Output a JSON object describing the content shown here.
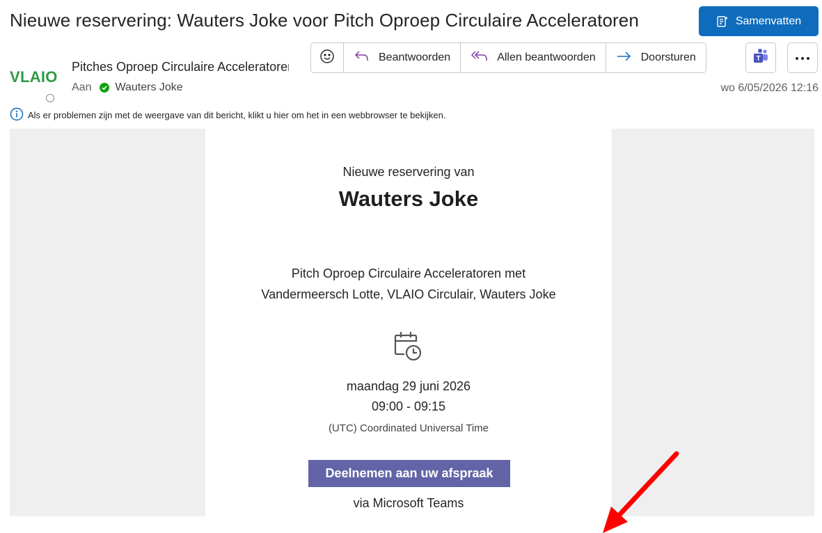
{
  "subject": "Nieuwe reservering: Wauters Joke voor Pitch Oproep Circulaire Acceleratoren",
  "summarize_label": "Samenvatten",
  "sender": {
    "logo_text": "VLAIO",
    "name": "Pitches Oproep Circulaire Acceleratoren",
    "to_label": "Aan",
    "recipient": "Wauters Joke",
    "date": "wo 6/05/2026 12:16"
  },
  "actions": {
    "reply": "Beantwoorden",
    "reply_all": "Allen beantwoorden",
    "forward": "Doorsturen"
  },
  "info_text": "Als er problemen zijn met de weergave van dit bericht, klikt u hier om het in een webbrowser te bekijken.",
  "body": {
    "intro": "Nieuwe reservering van",
    "name": "Wauters Joke",
    "desc_line1": "Pitch Oproep Circulaire Acceleratoren met",
    "desc_line2": "Vandermeersch Lotte, VLAIO Circulair, Wauters Joke",
    "date": "maandag 29 juni 2026",
    "time": "09:00 - 09:15",
    "timezone": "(UTC) Coordinated Universal Time",
    "join_label": "Deelnemen aan uw afspraak",
    "via": "via Microsoft Teams"
  },
  "colors": {
    "accent": "#0f6cbd",
    "logo_green": "#2e9a45",
    "teams_purple": "#6264a7",
    "annotation_arrow": "#ff0000"
  }
}
